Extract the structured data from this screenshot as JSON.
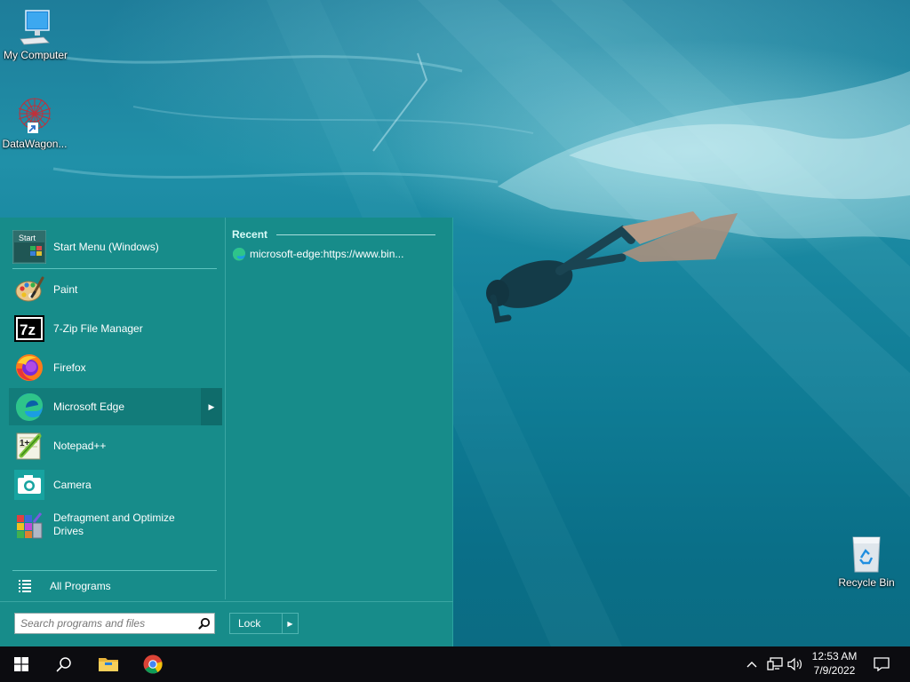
{
  "desktop": {
    "icons": [
      {
        "label": "My Computer",
        "icon": "computer-icon"
      },
      {
        "label": "DataWagon...",
        "icon": "datawagon-icon"
      },
      {
        "label": "Recycle Bin",
        "icon": "recycle-bin-icon"
      }
    ]
  },
  "start_menu": {
    "pinned": [
      {
        "label": "Start Menu (Windows)",
        "icon": "start-menu-icon"
      },
      {
        "label": "Paint",
        "icon": "paint-icon"
      },
      {
        "label": "7-Zip File Manager",
        "icon": "7zip-icon"
      },
      {
        "label": "Firefox",
        "icon": "firefox-icon"
      },
      {
        "label": "Microsoft Edge",
        "icon": "edge-icon",
        "selected": true
      },
      {
        "label": "Notepad++",
        "icon": "notepadpp-icon"
      },
      {
        "label": "Camera",
        "icon": "camera-icon"
      },
      {
        "label": "Defragment and Optimize Drives",
        "icon": "defrag-icon"
      }
    ],
    "start_icon_text": "Start",
    "all_programs": "All Programs",
    "recent": {
      "header": "Recent",
      "items": [
        {
          "label": "microsoft-edge:https://www.bin...",
          "icon": "edge-icon"
        }
      ]
    },
    "search": {
      "placeholder": "Search programs and files",
      "value": ""
    },
    "lock": {
      "label": "Lock"
    }
  },
  "taskbar": {
    "buttons": [
      {
        "name": "start-button",
        "icon": "windows-logo-icon"
      },
      {
        "name": "search-button",
        "icon": "search-icon"
      },
      {
        "name": "file-explorer-button",
        "icon": "folder-icon"
      },
      {
        "name": "chrome-button",
        "icon": "chrome-icon"
      }
    ],
    "tray": [
      "chevron-up-icon",
      "network-icon",
      "volume-icon"
    ],
    "clock": {
      "time": "12:53 AM",
      "date": "7/9/2022"
    },
    "notification_icon": "action-center-icon"
  }
}
